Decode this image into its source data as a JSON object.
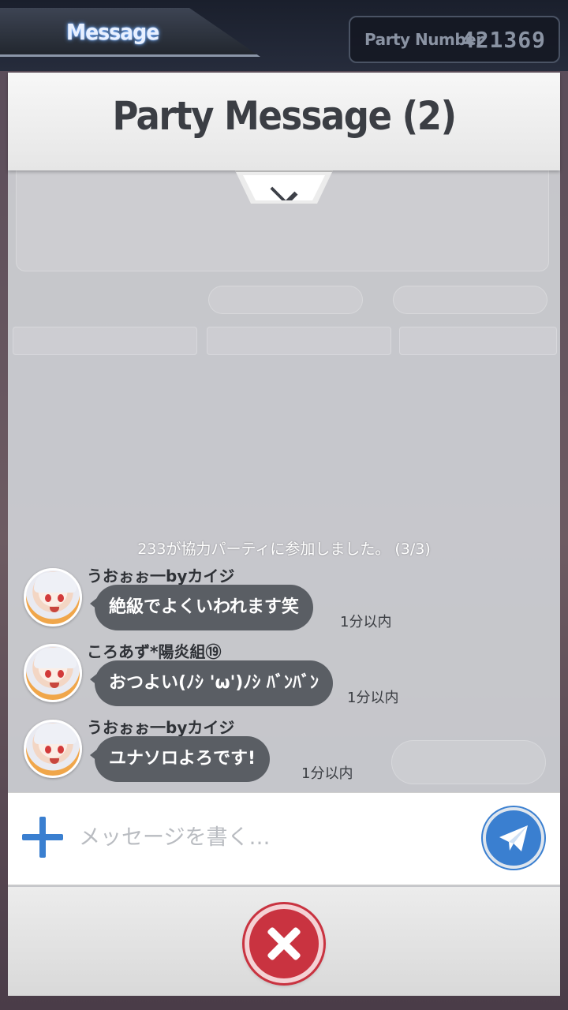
{
  "top_bar": {
    "message_tab_label": "Message",
    "party_number_label": "Party Number",
    "party_number_value": "421369"
  },
  "panel": {
    "title": "Party Message (2)"
  },
  "chat": {
    "system_message": "233が協力パーティに参加しました。 (3/3)",
    "messages": [
      {
        "sender": "うおぉぉ一byカイジ",
        "text": "絶級でよくいわれます笑",
        "time": "1分以内"
      },
      {
        "sender": "ころあず*陽炎組⑲",
        "text": "おつよい(ﾉｼ 'ω')ﾉｼ ﾊﾞﾝﾊﾞﾝ",
        "time": "1分以内"
      },
      {
        "sender": "うおぉぉ一byカイジ",
        "text": "ユナソロよろです!",
        "time": "1分以内"
      }
    ]
  },
  "input": {
    "placeholder": "メッセージを書く…",
    "value": ""
  },
  "icons": {
    "plus": "plus-icon",
    "send": "paper-plane-icon",
    "close": "close-icon",
    "collapse": "chevron-down-icon"
  },
  "colors": {
    "accent_blue": "#3a7fd0",
    "close_red": "#c93340",
    "bubble_gray": "#5a5e64"
  }
}
